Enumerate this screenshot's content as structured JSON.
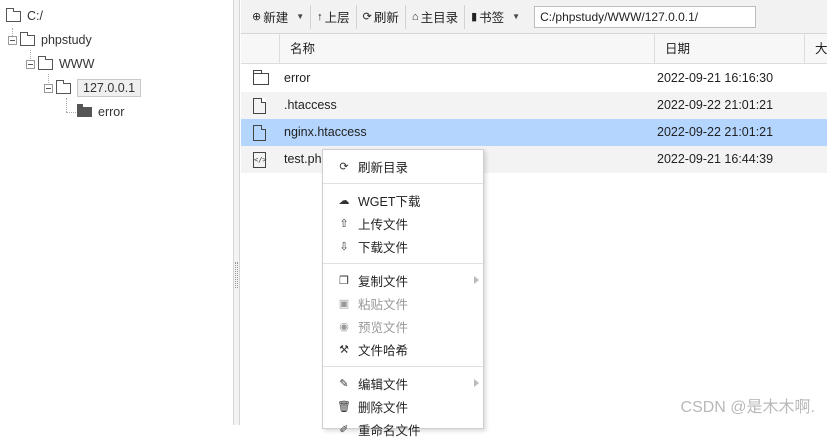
{
  "tree": {
    "nodes": [
      {
        "label": "C:/"
      },
      {
        "label": "phpstudy"
      },
      {
        "label": "WWW"
      },
      {
        "label": "127.0.0.1"
      },
      {
        "label": "error"
      }
    ]
  },
  "toolbar": {
    "new_label": "新建",
    "up_label": "上层",
    "refresh_label": "刷新",
    "home_label": "主目录",
    "bookmark_label": "书签",
    "path_value": "C:/phpstudy/WWW/127.0.0.1/"
  },
  "table": {
    "headers": [
      "名称",
      "日期",
      "大"
    ],
    "rows": [
      {
        "name": "error",
        "date": "2022-09-21 16:16:30",
        "icon": "folder-icon"
      },
      {
        "name": ".htaccess",
        "date": "2022-09-22 21:01:21",
        "icon": "file-icon"
      },
      {
        "name": "nginx.htaccess",
        "date": "2022-09-22 21:01:21",
        "icon": "file-icon"
      },
      {
        "name": "test.ph",
        "date": "2022-09-21 16:44:39",
        "icon": "code-file-icon"
      }
    ]
  },
  "context_menu": {
    "items": [
      {
        "label": "刷新目录",
        "icon": "refresh-icon"
      },
      {
        "label": "WGET下载",
        "icon": "cloud-download-icon"
      },
      {
        "label": "上传文件",
        "icon": "upload-icon"
      },
      {
        "label": "下载文件",
        "icon": "download-icon"
      },
      {
        "label": "复制文件",
        "icon": "copy-icon"
      },
      {
        "label": "粘贴文件",
        "icon": "paste-icon"
      },
      {
        "label": "预览文件",
        "icon": "eye-icon"
      },
      {
        "label": "文件哈希",
        "icon": "hammer-icon"
      },
      {
        "label": "编辑文件",
        "icon": "edit-icon"
      },
      {
        "label": "删除文件",
        "icon": "trash-icon"
      },
      {
        "label": "重命名文件",
        "icon": "rename-icon"
      }
    ]
  },
  "watermark": "CSDN @是木木啊.",
  "colors": {
    "selected_row": "#b4d5fe",
    "toolbar_bg": "#f2f2f2"
  }
}
